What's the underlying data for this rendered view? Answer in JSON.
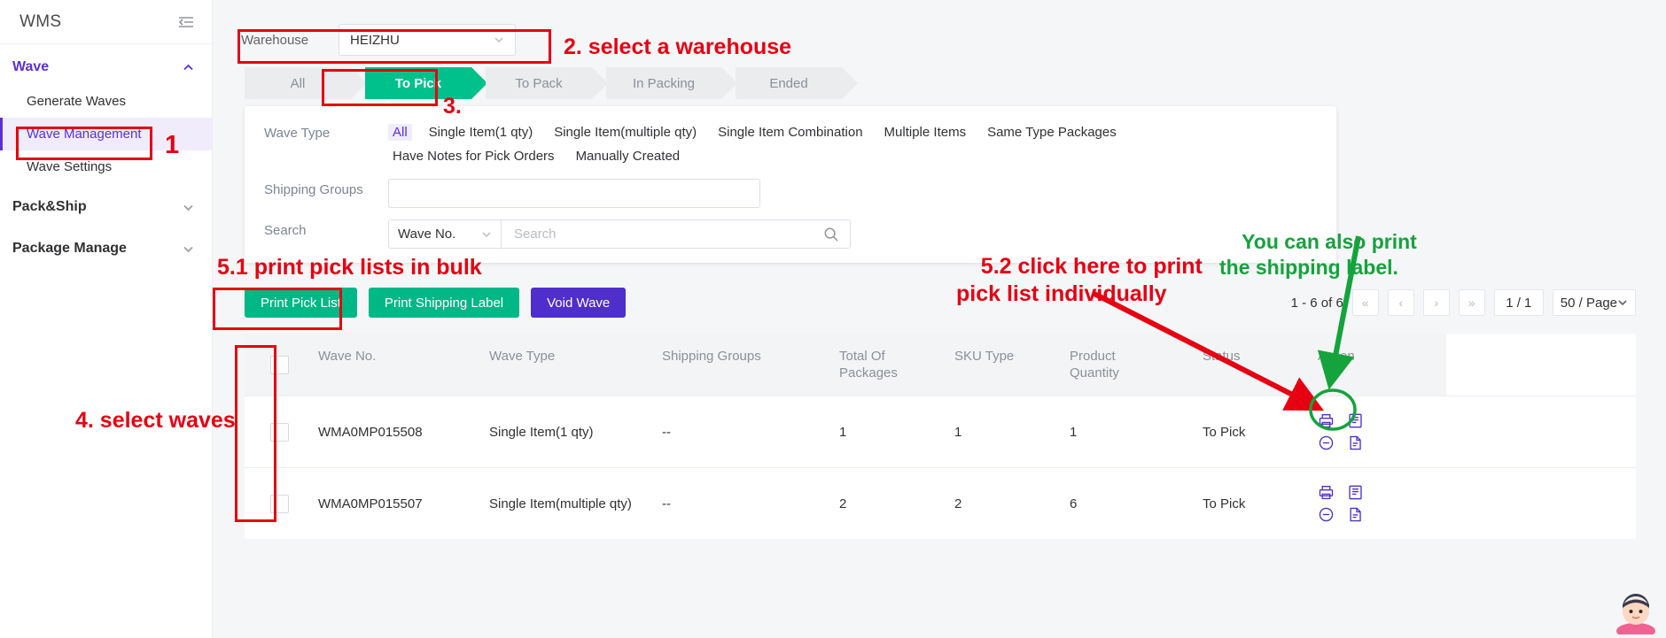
{
  "sidebar": {
    "brand": "WMS",
    "collapse_icon": "collapse-panel-icon",
    "groups": [
      {
        "label": "Wave",
        "expanded": true,
        "active": true,
        "chevron": "chevron-up-icon",
        "children": [
          {
            "label": "Generate Waves",
            "selected": false
          },
          {
            "label": "Wave Management",
            "selected": true
          },
          {
            "label": "Wave Settings",
            "selected": false
          }
        ]
      },
      {
        "label": "Pack&Ship",
        "expanded": false,
        "active": false,
        "chevron": "chevron-down-icon",
        "children": []
      },
      {
        "label": "Package Manage",
        "expanded": false,
        "active": false,
        "chevron": "chevron-down-icon",
        "children": []
      }
    ]
  },
  "warehouse": {
    "label": "Warehouse",
    "value": "HEIZHU",
    "chevron": "chevron-down-icon"
  },
  "steps": [
    {
      "label": "All",
      "active": false
    },
    {
      "label": "To Pick",
      "active": true
    },
    {
      "label": "To Pack",
      "active": false
    },
    {
      "label": "In Packing",
      "active": false
    },
    {
      "label": "Ended",
      "active": false
    }
  ],
  "filters": {
    "wave_type_label": "Wave Type",
    "wave_type_options": [
      {
        "label": "All",
        "selected": true
      },
      {
        "label": "Single Item(1 qty)",
        "selected": false
      },
      {
        "label": "Single Item(multiple qty)",
        "selected": false
      },
      {
        "label": "Single Item Combination",
        "selected": false
      },
      {
        "label": "Multiple Items",
        "selected": false
      },
      {
        "label": "Same Type Packages",
        "selected": false
      },
      {
        "label": "Have Notes for Pick Orders",
        "selected": false
      },
      {
        "label": "Manually Created",
        "selected": false
      }
    ],
    "shipping_groups_label": "Shipping Groups",
    "shipping_groups_value": "",
    "search_label": "Search",
    "search_field": "Wave No.",
    "search_field_chevron": "chevron-down-icon",
    "search_value": "",
    "search_placeholder": "Search",
    "search_icon": "search-icon"
  },
  "toolbar": {
    "print_pick_list": "Print Pick List",
    "print_shipping_label": "Print Shipping Label",
    "void_wave": "Void Wave",
    "colors": {
      "green": "#00b886",
      "purple": "#4f2fcb"
    }
  },
  "pagination": {
    "range": "1 - 6 of 6",
    "first": "«",
    "prev": "‹",
    "next": "›",
    "last": "»",
    "current": "1 / 1",
    "page_size": "50 / Page",
    "page_size_chevron": "chevron-down-icon"
  },
  "table": {
    "columns": [
      "",
      "Wave No.",
      "Wave Type",
      "Shipping Groups",
      "Total Of Packages",
      "SKU Type",
      "Product Quantity",
      "Status",
      "Action"
    ],
    "rows": [
      {
        "wave_no": "WMA0MP015508",
        "wave_type": "Single Item(1 qty)",
        "shipping_groups": "--",
        "total_packages": "1",
        "sku_type": "1",
        "product_quantity": "1",
        "status": "To Pick",
        "actions": [
          "printer-icon",
          "pick-list-icon",
          "void-icon",
          "shipping-label-icon"
        ]
      },
      {
        "wave_no": "WMA0MP015507",
        "wave_type": "Single Item(multiple qty)",
        "shipping_groups": "--",
        "total_packages": "2",
        "sku_type": "2",
        "product_quantity": "6",
        "status": "To Pick",
        "actions": [
          "printer-icon",
          "pick-list-icon",
          "void-icon",
          "shipping-label-icon"
        ]
      }
    ]
  },
  "annotations": {
    "step1": "1",
    "step2": "2. select a warehouse",
    "step3": "3.",
    "step4": "4. select waves",
    "step51": "5.1 print pick lists in bulk",
    "step52": "5.2 click here to print\npick list individually",
    "green_note": "You can also print\nthe shipping label.",
    "red": "#e60012",
    "green": "#14a33c"
  },
  "chat_icon": "customer-service-avatar-icon"
}
